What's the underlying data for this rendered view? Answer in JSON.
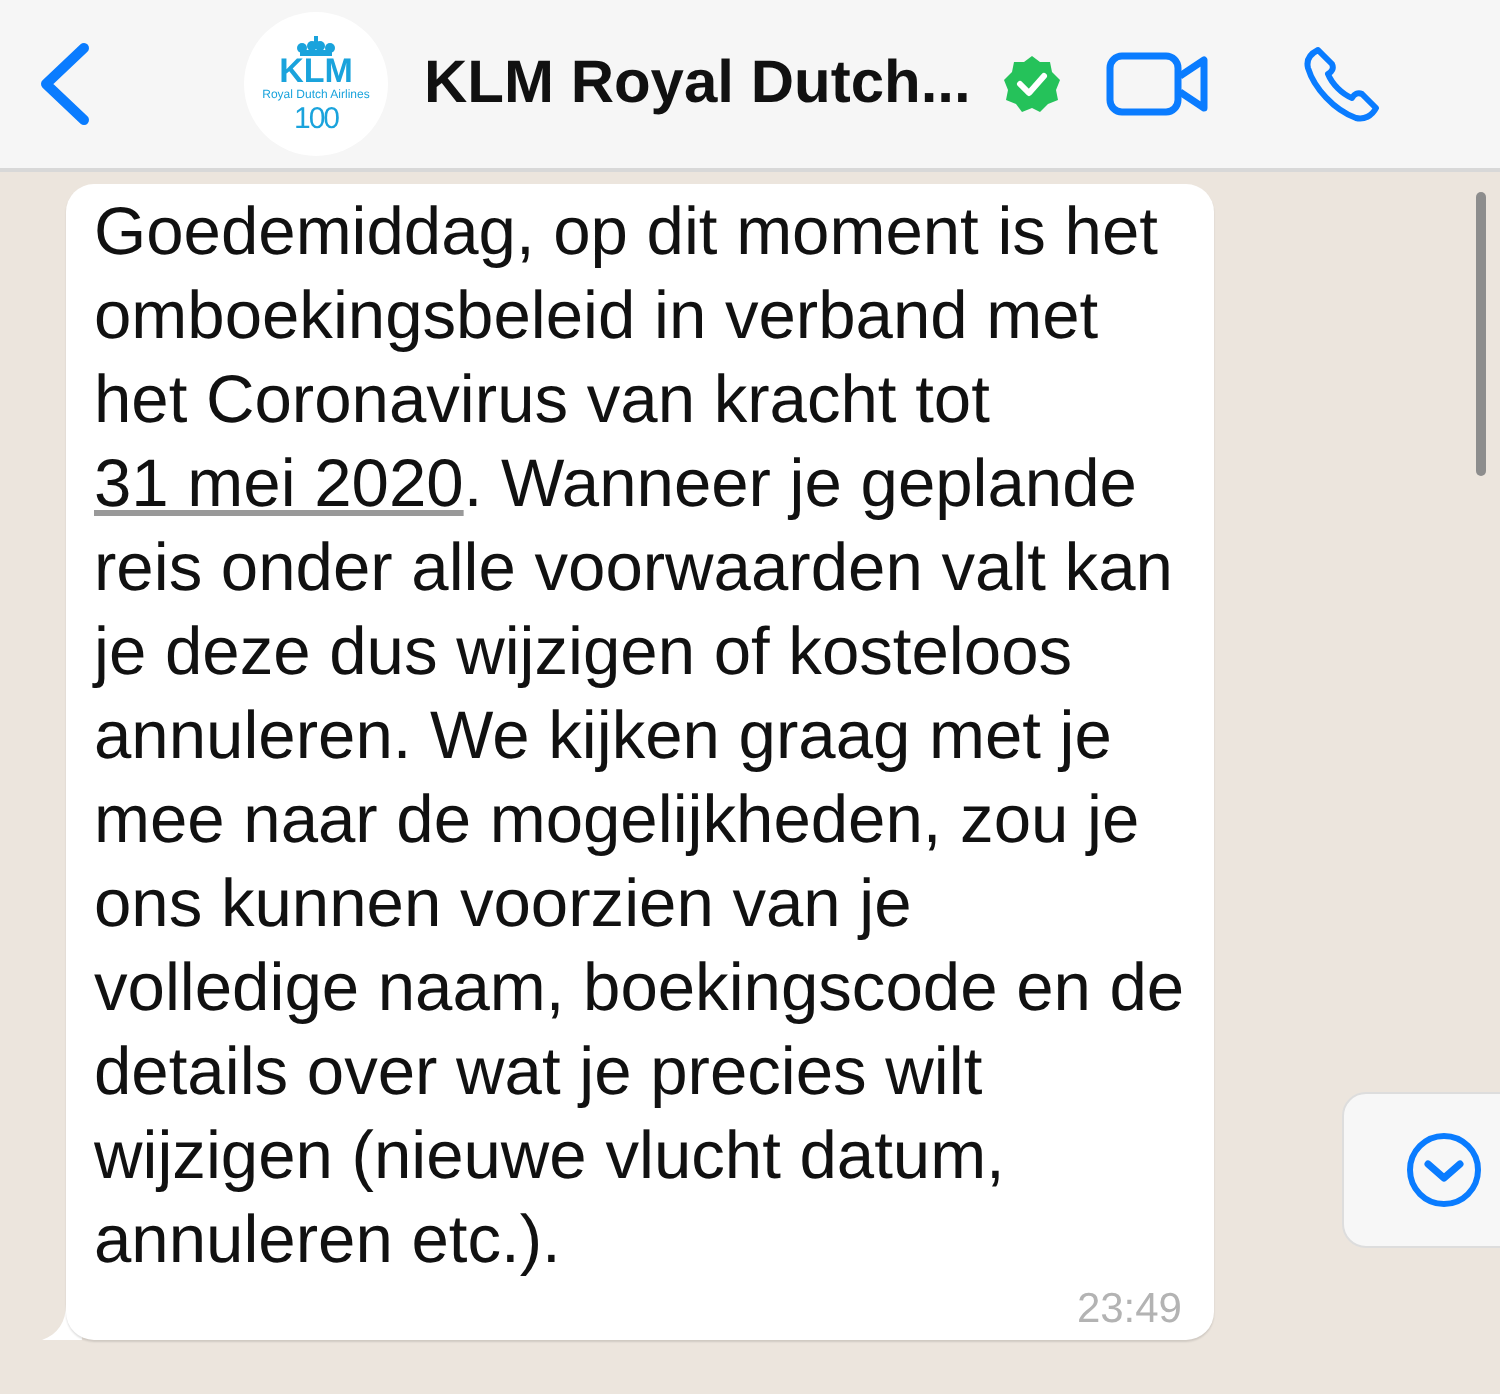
{
  "header": {
    "contact_name": "KLM Royal Dutch...",
    "verified": true,
    "avatar": {
      "brand": "KLM",
      "subtitle": "Royal Dutch Airlines",
      "anniversary": "100"
    }
  },
  "message": {
    "text_before": "Goedemiddag, op dit moment is het omboekingsbeleid in verband met het Coronavirus van kracht tot ",
    "link": "31 mei 2020",
    "text_after": ". Wanneer je geplande reis onder alle voorwaarden valt kan je deze dus wijzigen of kosteloos annuleren. We kijken graag met je mee naar de mogelijkheden, zou je ons kunnen voorzien van je volledige naam, boekingscode en de details over wat je precies wilt wijzigen (nieuwe vlucht datum, annuleren etc.).",
    "time": "23:49"
  }
}
